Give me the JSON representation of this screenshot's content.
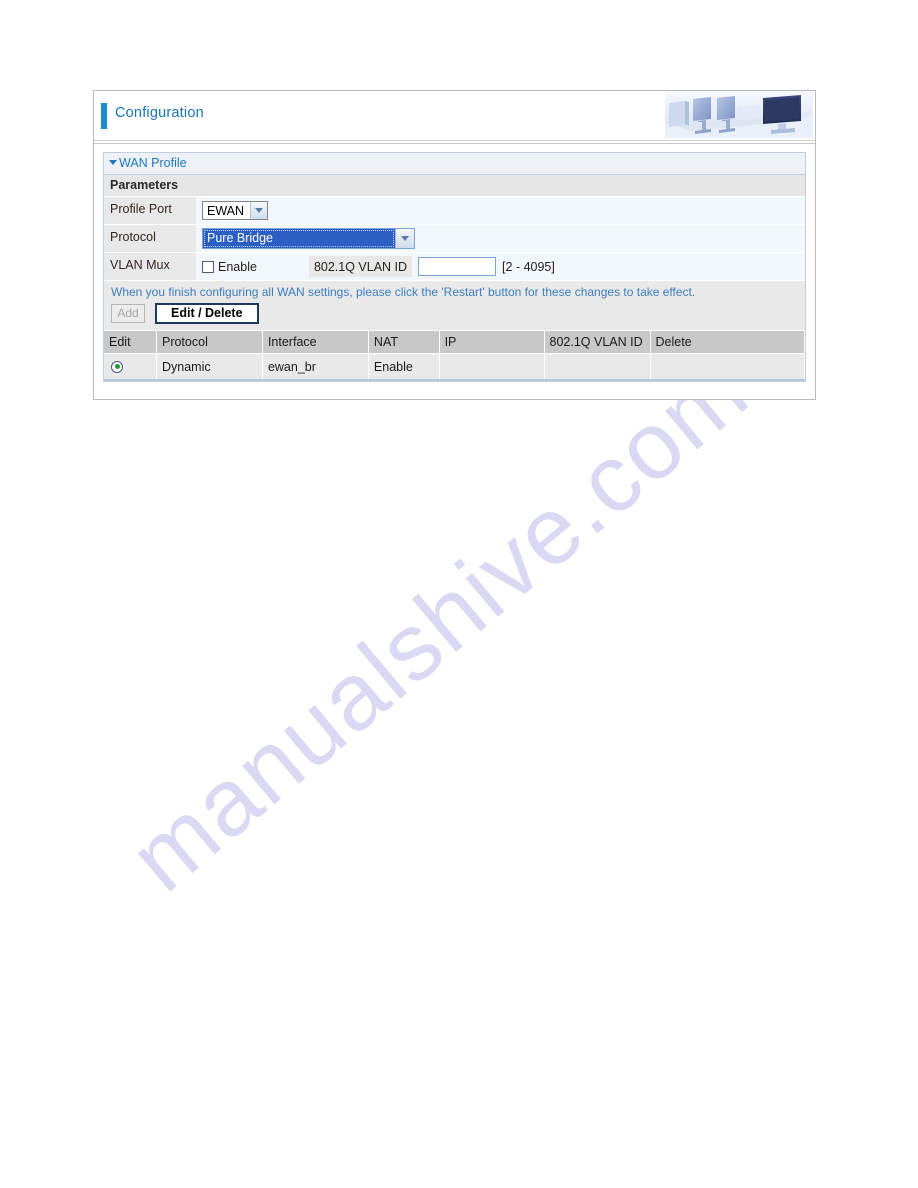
{
  "watermark": {
    "text": "manualshive.com"
  },
  "header": {
    "title": "Configuration",
    "photo_alt": "office-workstation-photo"
  },
  "panel": {
    "title": "WAN Profile",
    "section_title": "Parameters"
  },
  "form": {
    "profile_port": {
      "label": "Profile Port",
      "value": "EWAN"
    },
    "protocol": {
      "label": "Protocol",
      "value": "Pure Bridge"
    },
    "vlan_mux": {
      "label": "VLAN Mux",
      "enable_label": "Enable",
      "enable_checked": false,
      "vlan_id_label": "802.1Q VLAN ID",
      "vlan_id_value": "",
      "vlan_id_placeholder": "",
      "range_hint": "[2 - 4095]"
    }
  },
  "notice": {
    "text": "When you finish configuring all WAN settings, please click the 'Restart' button for these changes to take effect."
  },
  "buttons": {
    "add_label": "Add",
    "add_disabled": true,
    "edit_delete_label": "Edit / Delete"
  },
  "table": {
    "columns": [
      "Edit",
      "Protocol",
      "Interface",
      "NAT",
      "IP",
      "802.1Q VLAN ID",
      "Delete"
    ],
    "rows": [
      {
        "edit_selected": true,
        "protocol": "Dynamic",
        "interface": "ewan_br",
        "nat": "Enable",
        "ip": "",
        "vlan_id": "",
        "delete": ""
      }
    ]
  },
  "colors": {
    "accent_blue": "#1b8fd4",
    "title_blue": "#1976b5",
    "panel_title_blue": "#2277bb",
    "notice_blue": "#3d7ec0",
    "select_highlight": "#2b5fc4",
    "radio_dot_green": "#1f9b33",
    "watermark": "#d9d9f3"
  }
}
